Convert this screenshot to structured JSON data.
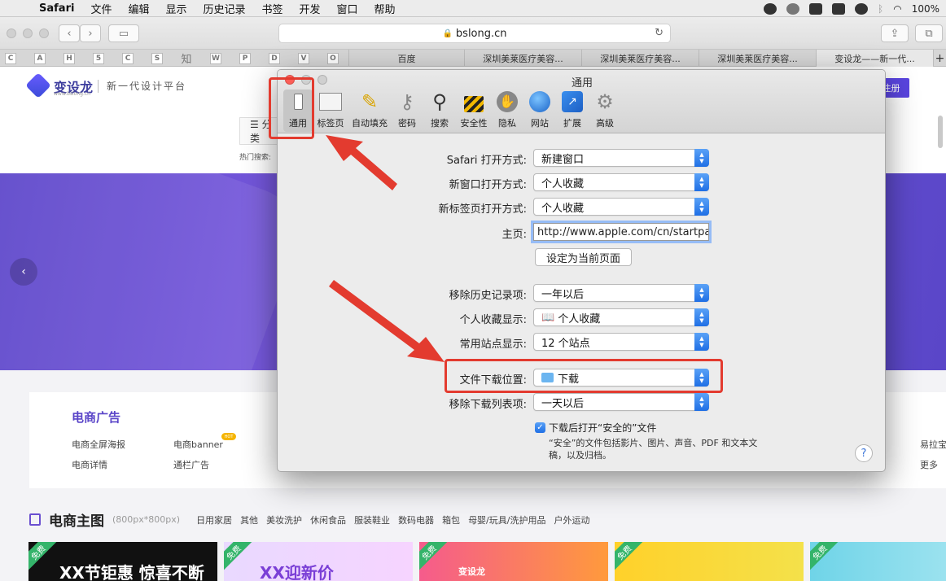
{
  "menubar": {
    "items": [
      "Safari",
      "文件",
      "编辑",
      "显示",
      "历史记录",
      "书签",
      "开发",
      "窗口",
      "帮助"
    ],
    "battery": "100%"
  },
  "browser": {
    "address": "bslong.cn",
    "bookmarks": [
      "C",
      "A",
      "H",
      "5",
      "C",
      "S",
      "知",
      "W",
      "P",
      "D",
      "V",
      "O"
    ],
    "tabs": [
      "百度",
      "深圳美莱医疗美容...",
      "深圳美莱医疗美容...",
      "深圳美莱医疗美容...",
      "变设龙——新一代..."
    ],
    "new_tab": "+"
  },
  "site": {
    "logo_name": "变设龙",
    "logo_sub": "www.bslong.cn",
    "slogan": "新一代设计平台",
    "register": "注册",
    "category_btn": "☰ 分类",
    "hot_search": "热门搜索:",
    "card": {
      "title": "电商广告",
      "items": [
        "电商全屏海报",
        "电商banner",
        "电商详情",
        "通栏广告"
      ],
      "hot_badge": "HOT",
      "right_items": [
        "易拉宝",
        "更多"
      ]
    },
    "section": {
      "title": "电商主图",
      "size": "(800px*800px)",
      "links": [
        "日用家居",
        "其他",
        "美妆洗护",
        "休闲食品",
        "服装鞋业",
        "数码电器",
        "箱包",
        "母婴/玩具/洗护用品",
        "户外运动"
      ]
    },
    "thumbs": [
      {
        "badge": "免费",
        "text": "XX节钜惠 惊喜不断"
      },
      {
        "badge": "免费",
        "text": "XX迎新价"
      },
      {
        "badge": "免费",
        "text": "变设龙"
      },
      {
        "badge": "免费",
        "text": ""
      },
      {
        "badge": "免费",
        "text": ""
      }
    ]
  },
  "prefs": {
    "title": "通用",
    "panes": [
      {
        "label": "通用",
        "icon": "switch-icon"
      },
      {
        "label": "标签页",
        "icon": "tabs-icon"
      },
      {
        "label": "自动填充",
        "icon": "pencil-icon"
      },
      {
        "label": "密码",
        "icon": "key-icon"
      },
      {
        "label": "搜索",
        "icon": "magnifier-icon"
      },
      {
        "label": "安全性",
        "icon": "lock-icon"
      },
      {
        "label": "隐私",
        "icon": "hand-icon"
      },
      {
        "label": "网站",
        "icon": "globe-icon"
      },
      {
        "label": "扩展",
        "icon": "puzzle-icon"
      },
      {
        "label": "高级",
        "icon": "gear-icon"
      }
    ],
    "rows": {
      "open_with_label": "Safari 打开方式:",
      "open_with_value": "新建窗口",
      "new_window_label": "新窗口打开方式:",
      "new_window_value": "个人收藏",
      "new_tab_label": "新标签页打开方式:",
      "new_tab_value": "个人收藏",
      "homepage_label": "主页:",
      "homepage_value": "http://www.apple.com/cn/startpage/",
      "set_current": "设定为当前页面",
      "remove_history_label": "移除历史记录项:",
      "remove_history_value": "一年以后",
      "favorites_label": "个人收藏显示:",
      "favorites_value": "个人收藏",
      "top_sites_label": "常用站点显示:",
      "top_sites_value": "12 个站点",
      "download_loc_label": "文件下载位置:",
      "download_loc_value": "下载",
      "remove_downloads_label": "移除下载列表项:",
      "remove_downloads_value": "一天以后",
      "open_safe_label": "下载后打开“安全的”文件",
      "open_safe_note": "“安全”的文件包括影片、图片、声音、PDF 和文本文稿，以及归档。",
      "help": "?"
    }
  },
  "colors": {
    "accent": "#2a7cf0",
    "annotation": "#e33b2f",
    "brand": "#5a45e0"
  }
}
